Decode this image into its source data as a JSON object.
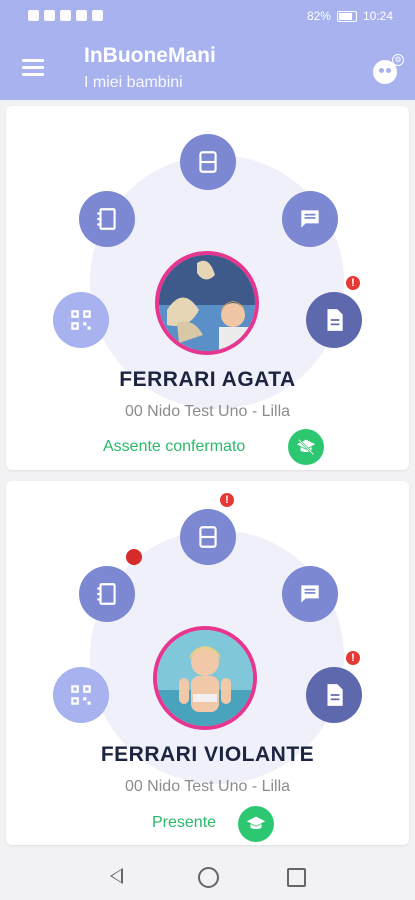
{
  "statusbar": {
    "battery": "82%",
    "time": "10:24"
  },
  "header": {
    "title": "InBuoneMani",
    "subtitle": "I miei bambini"
  },
  "colors": {
    "primary": "#a7b2ef",
    "button": "#7c88d1",
    "accent": "#e6368f",
    "ok": "#2ec771",
    "alert": "#e53935"
  },
  "children": [
    {
      "name": "FERRARI AGATA",
      "school": "00 Nido Test Uno - Lilla",
      "status": "Assente confermato",
      "status_icon": "graduation-cap-off-icon",
      "badges": {
        "document": "!"
      }
    },
    {
      "name": "FERRARI VIOLANTE",
      "school": "00 Nido Test Uno - Lilla",
      "status": "Presente",
      "status_icon": "graduation-cap-icon",
      "badges": {
        "calendar": "!",
        "document": "!"
      }
    }
  ]
}
